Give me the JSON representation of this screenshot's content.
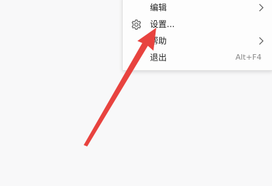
{
  "menu": {
    "items": [
      {
        "label": "编辑"
      },
      {
        "label": "设置..."
      },
      {
        "label": "帮助"
      },
      {
        "label": "退出",
        "shortcut": "Alt+F4"
      }
    ]
  },
  "colors": {
    "arrow": "#e8433f",
    "background": "#f8f8f9",
    "menu_bg": "#fdfdfd"
  },
  "icons": {
    "settings": "gear-icon",
    "submenu": "chevron-right-icon"
  }
}
